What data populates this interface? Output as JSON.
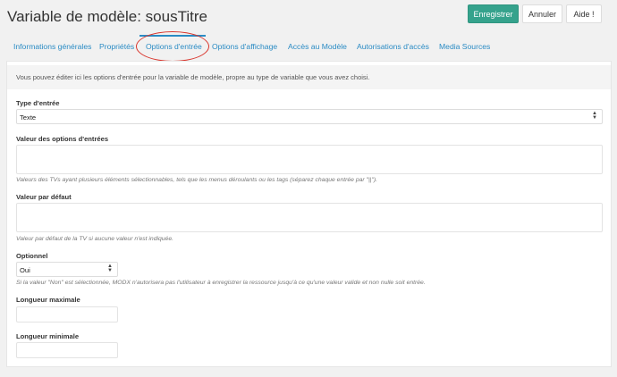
{
  "header": {
    "title": "Variable de modèle: sousTitre",
    "save_label": "Enregistrer",
    "cancel_label": "Annuler",
    "help_label": "Aide !"
  },
  "tabs": [
    {
      "label": "Informations générales"
    },
    {
      "label": "Propriétés"
    },
    {
      "label": "Options d'entrée"
    },
    {
      "label": "Options d'affichage"
    },
    {
      "label": "Accès au Modèle"
    },
    {
      "label": "Autorisations d'accès"
    },
    {
      "label": "Media Sources"
    }
  ],
  "active_tab": "Options d'entrée",
  "colors": {
    "accent": "#2a8bc4",
    "save_button": "#35a28c",
    "annotation": "#d9342b"
  },
  "panel": {
    "description": "Vous pouvez éditer ici les options d'entrée pour la variable de modèle, propre au type de variable que vous avez choisi."
  },
  "fields": {
    "input_type": {
      "label": "Type d'entrée",
      "value": "Texte"
    },
    "input_options": {
      "label": "Valeur des options d'entrées",
      "help": "Valeurs des TVs ayant plusieurs éléments sélectionnables, tels que les menus déroulants ou les tags (séparez chaque entrée par \"||\")."
    },
    "default_value": {
      "label": "Valeur par défaut",
      "help": "Valeur par défaut de la TV si aucune valeur n'est indiquée."
    },
    "optional": {
      "label": "Optionnel",
      "value": "Oui",
      "help": "Si la valeur \"Non\" est sélectionnée, MODX n'autorisera pas l'utilisateur à enregistrer la ressource jusqu'à ce qu'une valeur valide et non nulle soit entrée."
    },
    "max_length": {
      "label": "Longueur maximale"
    },
    "min_length": {
      "label": "Longueur minimale"
    }
  }
}
